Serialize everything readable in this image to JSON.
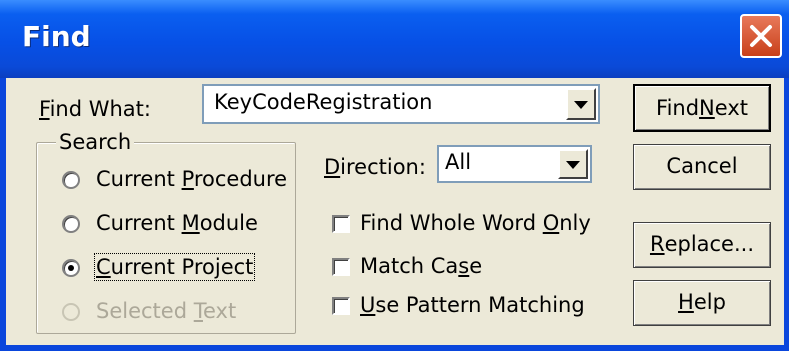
{
  "window": {
    "title": "Find"
  },
  "find_what": {
    "label_pre": "",
    "label_key": "F",
    "label_post": "ind What:",
    "value": "KeyCodeRegistration"
  },
  "search": {
    "title": "Search",
    "options": [
      {
        "pre": "Current ",
        "key": "P",
        "post": "rocedure",
        "selected": false,
        "enabled": true
      },
      {
        "pre": "Current ",
        "key": "M",
        "post": "odule",
        "selected": false,
        "enabled": true
      },
      {
        "pre": "",
        "key": "C",
        "post": "urrent Project",
        "selected": true,
        "enabled": true
      },
      {
        "pre": "Selected ",
        "key": "T",
        "post": "ext",
        "selected": false,
        "enabled": false
      }
    ]
  },
  "direction": {
    "label_pre": "",
    "label_key": "D",
    "label_post": "irection:",
    "value": "All"
  },
  "checks": [
    {
      "pre": "Find Whole Word ",
      "key": "O",
      "post": "nly",
      "checked": false
    },
    {
      "pre": "Match Ca",
      "key": "s",
      "post": "e",
      "checked": false
    },
    {
      "pre": "",
      "key": "U",
      "post": "se Pattern Matching",
      "checked": false
    }
  ],
  "buttons": {
    "find_next": {
      "pre": "Find ",
      "key": "N",
      "post": "ext"
    },
    "cancel": {
      "label": "Cancel"
    },
    "replace": {
      "pre": "",
      "key": "R",
      "post": "eplace..."
    },
    "help": {
      "pre": "",
      "key": "H",
      "post": "elp"
    }
  },
  "colors": {
    "titlebar": "#0750e6",
    "close": "#c8401a",
    "dialog_bg": "#ece9d8"
  }
}
